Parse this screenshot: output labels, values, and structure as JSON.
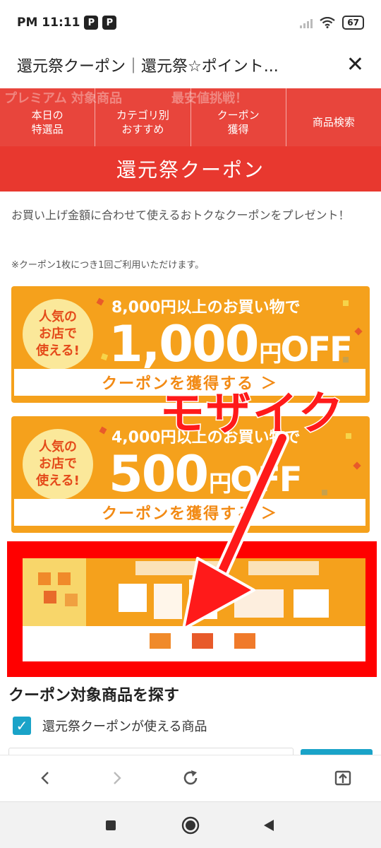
{
  "status": {
    "time": "PM 11:11",
    "app_icons": [
      "P",
      "P"
    ],
    "battery": "67"
  },
  "titlebar": {
    "title": "還元祭クーポン｜還元祭☆ポイント...",
    "close_icon": "close-icon"
  },
  "nav": {
    "background_text": [
      "プレミアム 対象商品",
      "最安値挑戦！"
    ],
    "items": [
      {
        "line1": "本日の",
        "line2": "特選品"
      },
      {
        "line1": "カテゴリ別",
        "line2": "おすすめ"
      },
      {
        "line1": "クーポン",
        "line2": "獲得"
      },
      {
        "line1": "商品検索",
        "line2": ""
      }
    ]
  },
  "header": {
    "title": "還元祭クーポン"
  },
  "intro": {
    "text": "お買い上げ金額に合わせて使えるおトクなクーポンをプレゼント！",
    "note": "※クーポン1枚につき1回ご利用いただけます。"
  },
  "coupons": [
    {
      "badge": "人気の お店で 使える!",
      "condition": "8,000円以上のお買い物で",
      "amount": "1,000",
      "unit": "円",
      "off": "OFF",
      "button": "クーポンを獲得する ＞"
    },
    {
      "badge": "人気の お店で 使える!",
      "condition": "4,000円以上のお買い物で",
      "amount": "500",
      "unit": "円",
      "off": "OFF",
      "button": "クーポンを獲得する ＞"
    }
  ],
  "annotation": {
    "text": "モザイク",
    "color": "#ff1a1a"
  },
  "search": {
    "title": "クーポン対象商品を探す",
    "checkbox_label": "還元祭クーポンが使える商品",
    "checked": true
  },
  "colors": {
    "brand_red": "#e8382f",
    "coupon_orange": "#f5a11c",
    "accent_blue": "#1aa3c8"
  }
}
